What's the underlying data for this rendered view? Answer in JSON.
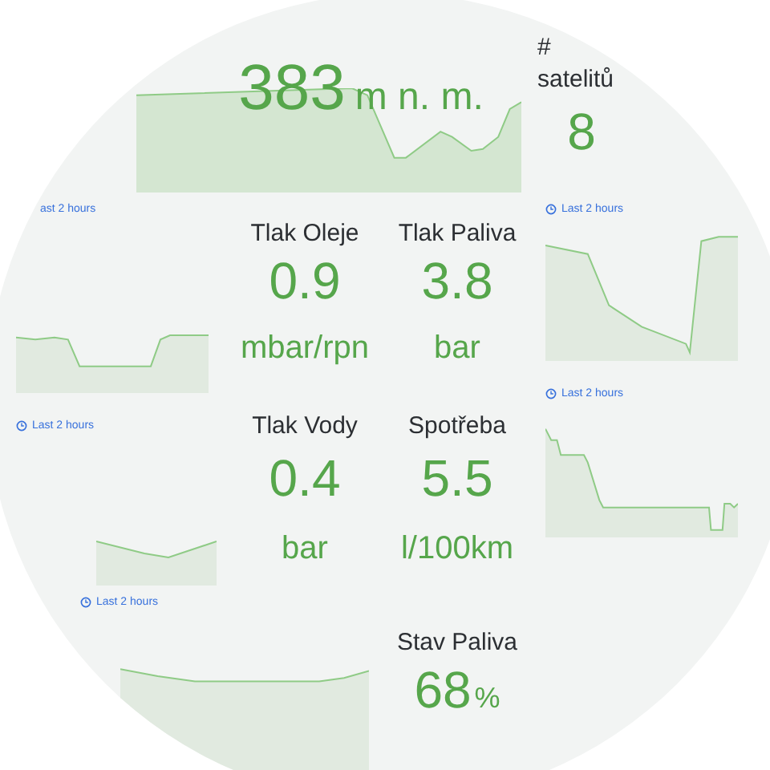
{
  "altitude": {
    "value": "383",
    "unit": "m n. m."
  },
  "satellites": {
    "title": "# satelitů",
    "value": "8"
  },
  "stats": [
    {
      "title": "Tlak Oleje",
      "value": "0.9",
      "unit": "mbar/rpn",
      "kind": "below"
    },
    {
      "title": "Tlak Paliva",
      "value": "3.8",
      "unit": "bar",
      "kind": "below"
    },
    {
      "title": "Tlak Vody",
      "value": "0.4",
      "unit": "bar",
      "kind": "below"
    },
    {
      "title": "Spotřeba",
      "value": "5.5",
      "unit": "l/100km",
      "kind": "below"
    },
    {
      "title": "Stav Paliva",
      "value": "68",
      "unit": "%",
      "kind": "inline"
    }
  ],
  "time_ranges": [
    {
      "label": "ast 2 hours",
      "clock_icon": false
    },
    {
      "label": "Last 2 hours",
      "clock_icon": true
    },
    {
      "label": "Last 2 hours",
      "clock_icon": true
    },
    {
      "label": "Last 2 hours",
      "clock_icon": true
    },
    {
      "label": "Last 2 hours",
      "clock_icon": true
    }
  ]
}
